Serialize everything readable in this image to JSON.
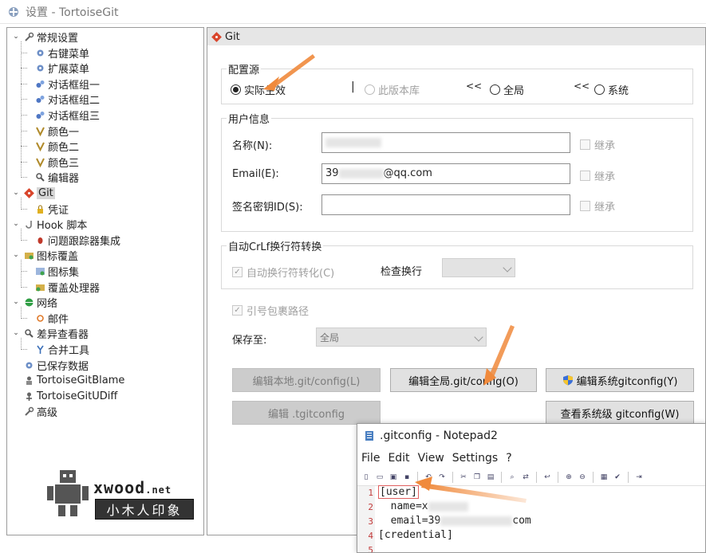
{
  "window": {
    "title": "设置 - TortoiseGit"
  },
  "tree": [
    {
      "label": "常规设置",
      "icon": "wrench-icon"
    },
    {
      "label": "右键菜单",
      "icon": "gear-icon"
    },
    {
      "label": "扩展菜单",
      "icon": "gear-icon"
    },
    {
      "label": "对话框组一",
      "icon": "gears-icon"
    },
    {
      "label": "对话框组二",
      "icon": "gears-icon"
    },
    {
      "label": "对话框组三",
      "icon": "gears-icon"
    },
    {
      "label": "颜色一",
      "icon": "palette-icon"
    },
    {
      "label": "颜色二",
      "icon": "palette-icon"
    },
    {
      "label": "颜色三",
      "icon": "palette-icon"
    },
    {
      "label": "编辑器",
      "icon": "magnifier-icon"
    },
    {
      "label": "Git",
      "icon": "git-icon"
    },
    {
      "label": "凭证",
      "icon": "lock-icon"
    },
    {
      "label": "Hook 脚本",
      "icon": "hook-icon"
    },
    {
      "label": "问题跟踪器集成",
      "icon": "bug-icon"
    },
    {
      "label": "图标覆盖",
      "icon": "overlay-icon"
    },
    {
      "label": "图标集",
      "icon": "iconset-icon"
    },
    {
      "label": "覆盖处理器",
      "icon": "overlay-handler-icon"
    },
    {
      "label": "网络",
      "icon": "globe-icon"
    },
    {
      "label": "邮件",
      "icon": "mail-icon"
    },
    {
      "label": "差异查看器",
      "icon": "magnifier-icon"
    },
    {
      "label": "合并工具",
      "icon": "merge-icon"
    },
    {
      "label": "已保存数据",
      "icon": "gear-icon"
    },
    {
      "label": "TortoiseGitBlame",
      "icon": "blame-icon"
    },
    {
      "label": "TortoiseGitUDiff",
      "icon": "udiff-icon"
    },
    {
      "label": "高级",
      "icon": "wrench-icon"
    }
  ],
  "watermark": {
    "brand": "xwood",
    "tld": ".net",
    "sub": "小木人印象"
  },
  "panel": {
    "title": "Git"
  },
  "config_source": {
    "legend": "配置源",
    "options": [
      "实际生效",
      "此版本库",
      "全局",
      "系统"
    ],
    "sep_bar": "|",
    "sep_arrow": "<<",
    "selected": "实际生效"
  },
  "user_info": {
    "legend": "用户信息",
    "name_label": "名称(N):",
    "name_value": "",
    "email_label": "Email(E):",
    "email_prefix": "39",
    "email_suffix": "@qq.com",
    "sign_label": "签名密钥ID(S):",
    "sign_value": "",
    "inherit": "继承"
  },
  "autocrlf": {
    "legend": "自动CrLf换行符转换",
    "auto_label": "自动换行符转化(C)",
    "check_label": "检查换行",
    "check_value": ""
  },
  "quote_path": {
    "label": "引号包裹路径"
  },
  "save_to": {
    "label": "保存至:",
    "value": "全局"
  },
  "buttons": {
    "edit_local": "编辑本地.git/config(L)",
    "edit_global": "编辑全局.git/config(O)",
    "edit_system": "编辑系统gitconfig(Y)",
    "edit_tgit": "编辑 .tgitconfig",
    "view_system": "查看系统级 gitconfig(W)"
  },
  "notepad": {
    "title": ".gitconfig - Notepad2",
    "menu": [
      "File",
      "Edit",
      "View",
      "Settings",
      "?"
    ],
    "line_numbers": [
      "1",
      "2",
      "3",
      "4",
      "5"
    ],
    "lines": [
      "[user]",
      "  name=x",
      "  email=39",
      "[credential]",
      ""
    ],
    "email_tail": "com"
  },
  "colors": {
    "accent_arrow": "#f08a3c",
    "git_red": "#d9452b"
  }
}
